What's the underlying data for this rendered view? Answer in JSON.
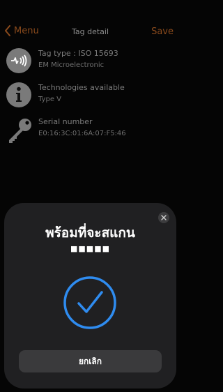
{
  "nav": {
    "back_label": "Menu",
    "title": "Tag detail",
    "save_label": "Save"
  },
  "rows": [
    {
      "icon": "nfc-wave-icon",
      "label": "Tag type : ISO 15693",
      "value": "EM Microelectronic"
    },
    {
      "icon": "info-icon",
      "label": "Technologies available",
      "value": "Type V"
    },
    {
      "icon": "key-icon",
      "label": "Serial number",
      "value": "E0:16:3C:01:6A:07:F5:46"
    }
  ],
  "sheet": {
    "title": "พร้อมที่จะสแกน",
    "progress": "■■■■■",
    "status_icon": "checkmark-circle-icon",
    "cancel_label": "ยกเลิก"
  },
  "colors": {
    "accent": "#8a4a1c",
    "check": "#2f8cf0",
    "sheet": "#202022"
  }
}
